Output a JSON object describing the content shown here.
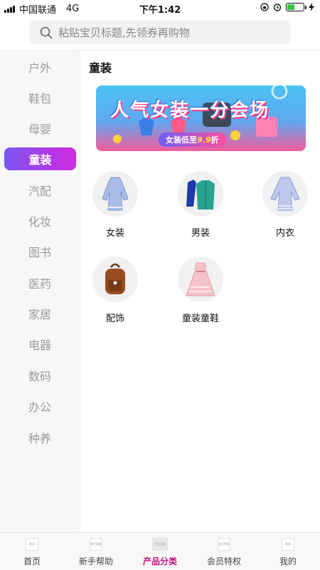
{
  "status_bar": {
    "carrier": "中国联通",
    "network": "4G",
    "time": "下午1:42",
    "battery_level": 0.45
  },
  "search": {
    "placeholder": "粘贴宝贝标题,先领券再购物"
  },
  "sidebar": {
    "items": [
      {
        "label": "户外",
        "active": false
      },
      {
        "label": "鞋包",
        "active": false
      },
      {
        "label": "母婴",
        "active": false
      },
      {
        "label": "童装",
        "active": true
      },
      {
        "label": "汽配",
        "active": false
      },
      {
        "label": "化妆",
        "active": false
      },
      {
        "label": "图书",
        "active": false
      },
      {
        "label": "医药",
        "active": false
      },
      {
        "label": "家居",
        "active": false
      },
      {
        "label": "电器",
        "active": false
      },
      {
        "label": "数码",
        "active": false
      },
      {
        "label": "办公",
        "active": false
      },
      {
        "label": "种养",
        "active": false
      }
    ]
  },
  "content": {
    "title": "童装",
    "banner": {
      "headline": "人气女装一分会场",
      "sub_prefix": "女装低至",
      "sub_value": "9.9",
      "sub_suffix": "折"
    },
    "categories": [
      {
        "label": "女装",
        "icon": "dress-icon"
      },
      {
        "label": "男装",
        "icon": "jacket-icon"
      },
      {
        "label": "内衣",
        "icon": "blouse-icon"
      },
      {
        "label": "配饰",
        "icon": "backpack-icon"
      },
      {
        "label": "童装童鞋",
        "icon": "kids-dress-icon"
      }
    ]
  },
  "bottom_nav": {
    "items": [
      {
        "label": "首页",
        "icon_text": "首页",
        "active": false
      },
      {
        "label": "新手帮助",
        "icon_text": "新手帮助",
        "active": false
      },
      {
        "label": "产品分类",
        "icon_text": "产品分类",
        "active": true
      },
      {
        "label": "会员特权",
        "icon_text": "会员特权",
        "active": false
      },
      {
        "label": "我的",
        "icon_text": "我的",
        "active": false
      }
    ]
  },
  "colors": {
    "accent_gradient_start": "#7b55f0",
    "accent_gradient_end": "#d02be0",
    "active_nav": "#c0137d",
    "battery": "#36c43a"
  }
}
